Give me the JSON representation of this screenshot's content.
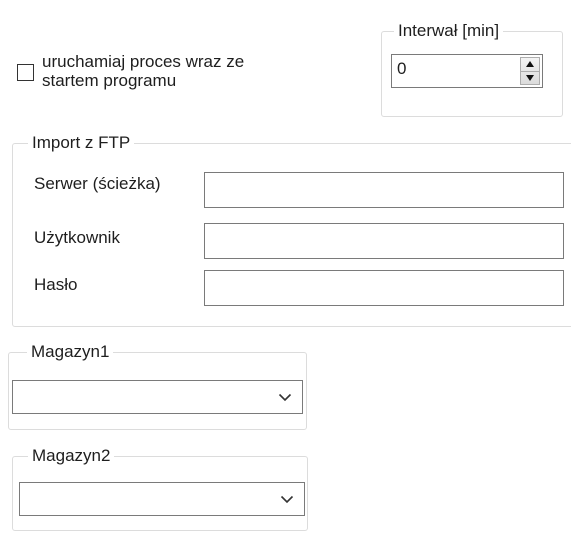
{
  "autostart": {
    "checked": false,
    "label_line1": "uruchamiaj proces wraz ze",
    "label_line2": "startem programu"
  },
  "interval": {
    "legend": "Interwał [min]",
    "value": "0"
  },
  "ftp_import": {
    "legend": "Import z FTP",
    "server_label": "Serwer (ścieżka)",
    "server_value": "",
    "user_label": "Użytkownik",
    "user_value": "",
    "password_label": "Hasło",
    "password_value": ""
  },
  "warehouse1": {
    "legend": "Magazyn1",
    "selected": ""
  },
  "warehouse2": {
    "legend": "Magazyn2",
    "selected": ""
  },
  "icons": {
    "spin_up": "triangle-up",
    "spin_down": "triangle-down",
    "combo_dropdown": "chevron-down"
  }
}
